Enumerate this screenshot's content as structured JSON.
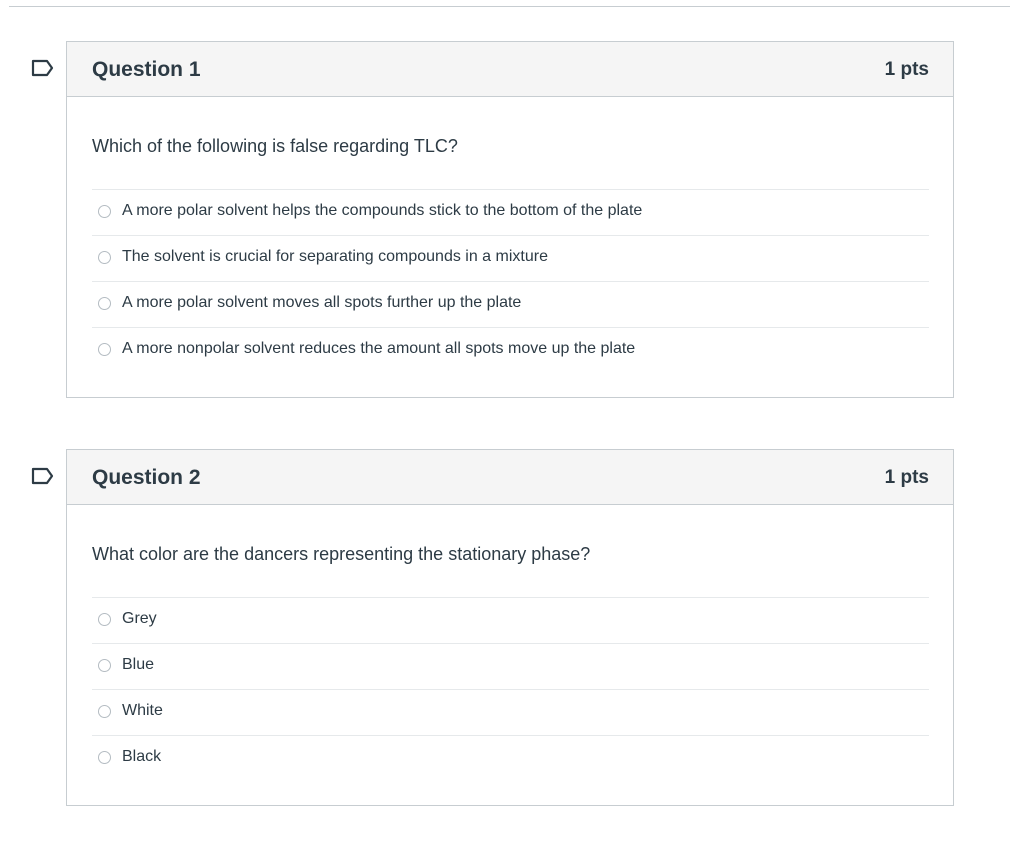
{
  "questions": [
    {
      "title": "Question 1",
      "points": "1 pts",
      "text": "Which of the following is false regarding TLC?",
      "flag_icon": "flag-bookmark-icon",
      "answers": [
        "A more polar solvent helps the compounds stick to the bottom of the plate",
        "The solvent is crucial for separating compounds in a mixture",
        "A more polar solvent moves all spots further up the plate",
        "A more nonpolar solvent reduces the amount all spots move up the plate"
      ]
    },
    {
      "title": "Question 2",
      "points": "1 pts",
      "text": "What color are the dancers representing the stationary phase?",
      "flag_icon": "flag-bookmark-icon",
      "answers": [
        "Grey",
        "Blue",
        "White",
        "Black"
      ]
    }
  ],
  "colors": {
    "border": "#c7cdd1",
    "header_bg": "#f5f5f5",
    "text": "#2d3b45",
    "flag_stroke": "#2d3b45",
    "radio_border": "#b4bcc2"
  }
}
